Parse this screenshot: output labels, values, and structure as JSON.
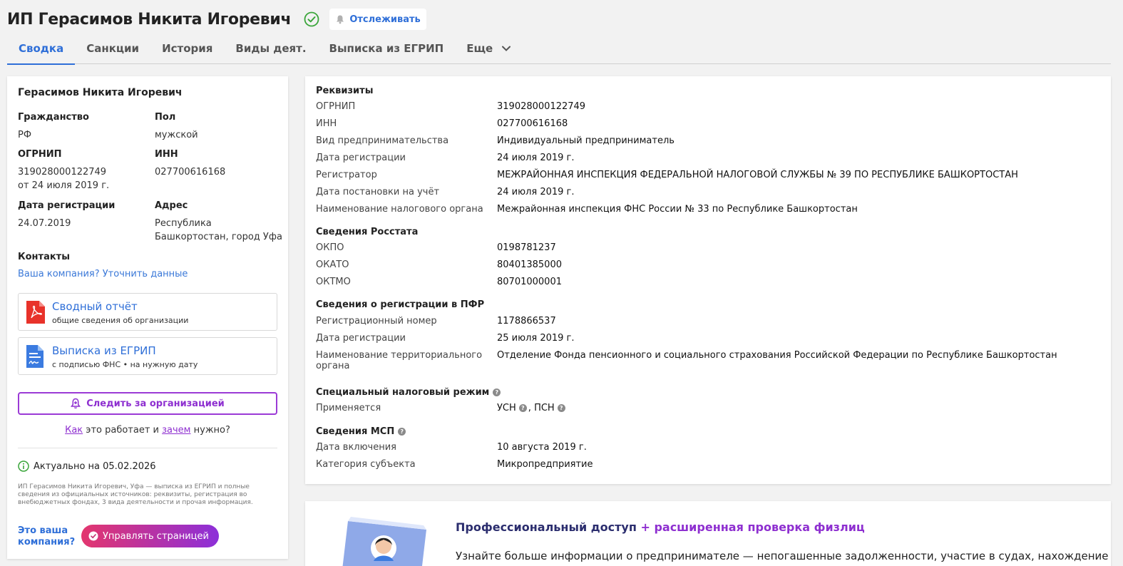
{
  "header": {
    "title": "ИП Герасимов Никита Игоревич",
    "track_label": "Отслеживать"
  },
  "tabs": [
    {
      "label": "Сводка"
    },
    {
      "label": "Санкции"
    },
    {
      "label": "История"
    },
    {
      "label": "Виды деят."
    },
    {
      "label": "Выписка из ЕГРИП"
    },
    {
      "label": "Еще"
    }
  ],
  "left": {
    "name": "Герасимов Никита Игоревич",
    "citizenship_label": "Гражданство",
    "citizenship": "РФ",
    "gender_label": "Пол",
    "gender": "мужской",
    "ogrnip_label": "ОГРНИП",
    "ogrnip": "319028000122749",
    "ogrnip_date": "от 24 июля 2019 г.",
    "inn_label": "ИНН",
    "inn": "027700616168",
    "regdate_label": "Дата регистрации",
    "regdate": "24.07.2019",
    "address_label": "Адрес",
    "address_1": "Республика",
    "address_2": "Башкортостан, город Уфа",
    "contacts_label": "Контакты",
    "contacts_link": "Ваша компания? Уточнить данные",
    "doc1_title": "Сводный отчёт",
    "doc1_sub": "общие сведения об организации",
    "doc2_title": "Выписка из ЕГРИП",
    "doc2_sub": "с подписью ФНС • на нужную дату",
    "follow_label": "Следить за организацией",
    "how_1": "Как",
    "how_2": " это работает и ",
    "how_3": "зачем",
    "how_4": " нужно?",
    "actual": "Актуально на 05.02.2026",
    "desc": "ИП Герасимов Никита Игоревич, Уфа — выписка из ЕГРИП и полные сведения из официальных источников: реквизиты, регистрация во внебюджетных фондах, 3 вида деятельности и прочая информация.",
    "your_company_1": "Это ваша",
    "your_company_2": "компания?",
    "manage_label": "Управлять страницей"
  },
  "details": {
    "rekv_title": "Реквизиты",
    "rekv": [
      {
        "k": "ОГРНИП",
        "v": "319028000122749"
      },
      {
        "k": "ИНН",
        "v": "027700616168"
      },
      {
        "k": "Вид предпринимательства",
        "v": "Индивидуальный предприниматель"
      },
      {
        "k": "Дата регистрации",
        "v": "24 июля 2019 г."
      },
      {
        "k": "Регистратор",
        "v": "МЕЖРАЙОННАЯ ИНСПЕКЦИЯ ФЕДЕРАЛЬНОЙ НАЛОГОВОЙ СЛУЖБЫ № 39 ПО РЕСПУБЛИКЕ БАШКОРТОСТАН"
      },
      {
        "k": "Дата постановки на учёт",
        "v": "24 июля 2019 г."
      },
      {
        "k": "Наименование налогового органа",
        "v": "Межрайонная инспекция ФНС России № 33 по Республике Башкортостан"
      }
    ],
    "rosstat_title": "Сведения Росстата",
    "rosstat": [
      {
        "k": "ОКПО",
        "v": "0198781237"
      },
      {
        "k": "ОКАТО",
        "v": "80401385000"
      },
      {
        "k": "ОКТМО",
        "v": "80701000001"
      }
    ],
    "pfr_title": "Сведения о регистрации в ПФР",
    "pfr": [
      {
        "k": "Регистрационный номер",
        "v": "1178866537"
      },
      {
        "k": "Дата регистрации",
        "v": "25 июля 2019 г."
      },
      {
        "k": "Наименование территориального органа",
        "v": "Отделение Фонда пенсионного и социального страхования Российской Федерации по Республике Башкортостан"
      }
    ],
    "tax_title": "Специальный налоговый режим",
    "tax_k": "Применяется",
    "tax_v1": "УСН",
    "tax_sep": ",",
    "tax_v2": "ПСН",
    "msp_title": "Сведения МСП",
    "msp": [
      {
        "k": "Дата включения",
        "v": "10 августа 2019 г."
      },
      {
        "k": "Категория субъекта",
        "v": "Микропредприятие"
      }
    ]
  },
  "promo": {
    "title_main": "Профессиональный доступ",
    "title_plus": "+ расширенная проверка физлиц",
    "text": "Узнайте больше информации о предпринимателе — непогашенные задолженности, участие в судах, нахождение"
  },
  "colors": {
    "accent": "#2f6fd8",
    "purple": "#8e2fd0",
    "green": "#3aa53a"
  }
}
